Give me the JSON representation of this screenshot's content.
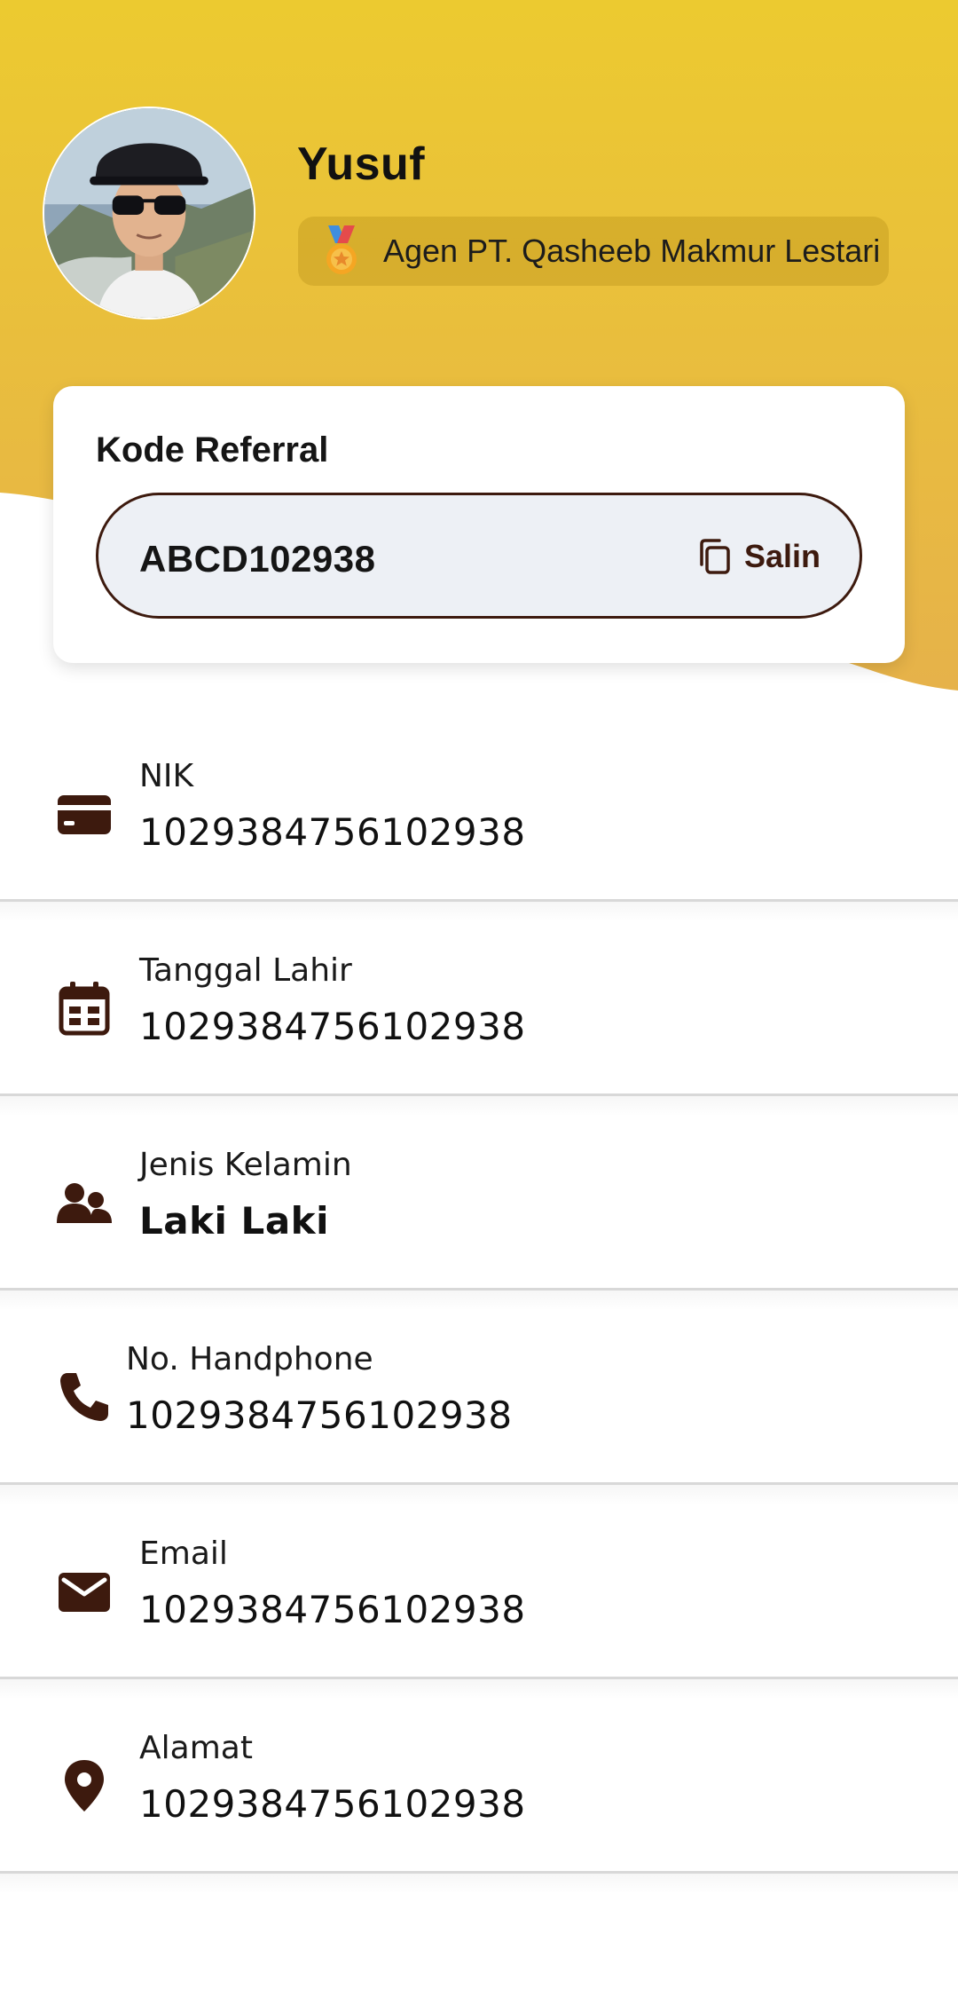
{
  "colors": {
    "header_gradient_top": "#ecca30",
    "header_gradient_bottom": "#e6b24a",
    "accent_brown": "#3d1a0e",
    "referral_box_bg": "#edf0f5"
  },
  "profile": {
    "name": "Yusuf",
    "role_icon": "medal-icon",
    "role": "Agen PT. Qasheeb Makmur Lestari"
  },
  "referral": {
    "title": "Kode Referral",
    "code": "ABCD102938",
    "copy_label": "Salin",
    "copy_icon": "copy-icon"
  },
  "info_items": [
    {
      "icon": "id-card-icon",
      "label": "NIK",
      "value": "1029384756102938"
    },
    {
      "icon": "calendar-icon",
      "label": "Tanggal Lahir",
      "value": "1029384756102938"
    },
    {
      "icon": "people-icon",
      "label": "Jenis Kelamin",
      "value": "Laki Laki"
    },
    {
      "icon": "phone-icon",
      "label": "No. Handphone",
      "value": "1029384756102938"
    },
    {
      "icon": "mail-icon",
      "label": "Email",
      "value": "1029384756102938"
    },
    {
      "icon": "location-pin-icon",
      "label": "Alamat",
      "value": "1029384756102938"
    }
  ]
}
